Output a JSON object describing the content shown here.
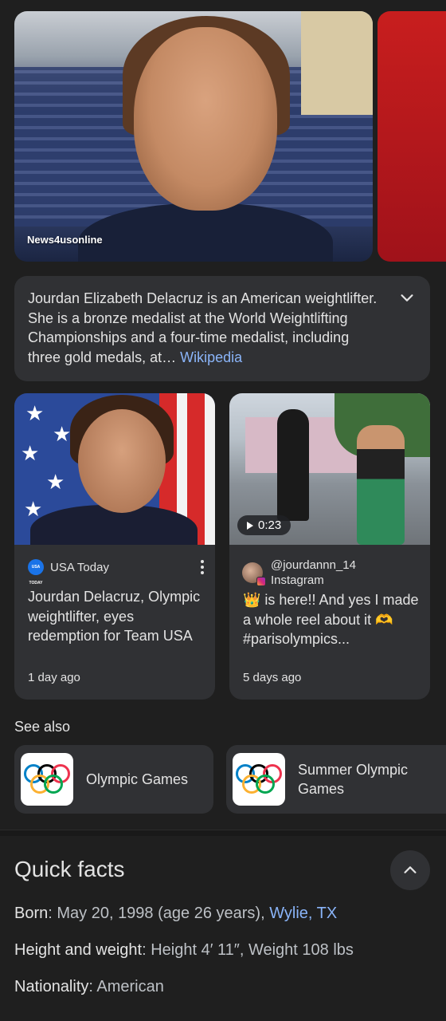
{
  "hero": {
    "caption": "News4usonline"
  },
  "description": {
    "text": "Jourdan Elizabeth Delacruz is an American weightlifter. She is a bronze medalist at the World Weightlifting Championships and a four-time medalist, including three gold medals, at… ",
    "source_link": "Wikipedia"
  },
  "news": [
    {
      "source": "USA Today",
      "source_logo_text": "USA TODAY",
      "title": "Jourdan Delacruz, Olympic weightlifter, eyes redemption for Team USA",
      "time": "1 day ago"
    },
    {
      "handle": "@jourdannn_14",
      "platform": "Instagram",
      "duration": "0:23",
      "title": "👑 is here!! And yes I made a whole reel about it 🫶 #parisolympics...",
      "time": "5 days ago"
    }
  ],
  "see_also": {
    "heading": "See also",
    "items": [
      {
        "label": "Olympic Games"
      },
      {
        "label": "Summer Olympic Games"
      }
    ]
  },
  "quick_facts": {
    "heading": "Quick facts",
    "born_label": "Born",
    "born_value": ": May 20, 1998 (age 26 years), ",
    "born_place": "Wylie, TX",
    "hw_label": "Height and weight",
    "hw_value": ": Height 4′ 11″, Weight 108 lbs",
    "nat_label": "Nationality",
    "nat_value": ": American"
  },
  "colors": {
    "background": "#1f1f1f",
    "card": "#303134",
    "link": "#8ab4f8",
    "text": "#e3e3e3"
  },
  "icons": {
    "expand": "chevron-down-icon",
    "collapse": "chevron-up-icon",
    "more": "more-vert-icon",
    "play": "play-icon"
  }
}
